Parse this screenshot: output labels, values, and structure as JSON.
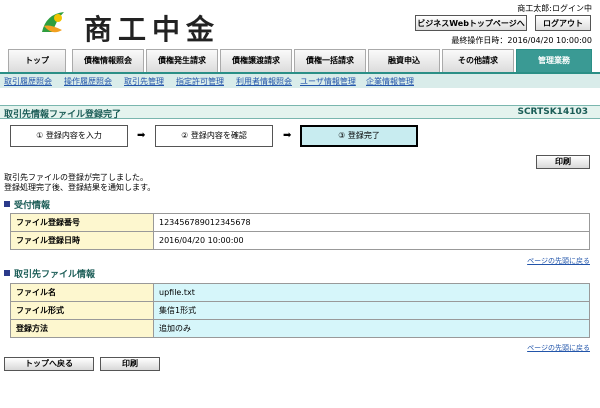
{
  "header": {
    "bank_name": "商工中金",
    "user": "商工太郎:ログイン中",
    "web_top_button": "ビジネスWebトップページへ",
    "logout_button": "ログアウト",
    "last_operation": "最終操作日時：2016/04/20 10:00:00"
  },
  "tabs": [
    {
      "label": "トップ"
    },
    {
      "label": "債権情報照会"
    },
    {
      "label": "債権発生請求"
    },
    {
      "label": "債権譲渡請求"
    },
    {
      "label": "債権一括請求"
    },
    {
      "label": "融資申込"
    },
    {
      "label": "その他請求"
    },
    {
      "label": "管理業務"
    }
  ],
  "subnav": [
    "取引履歴照会",
    "操作履歴照会",
    "取引先管理",
    "指定許可管理",
    "利用者情報照会",
    "ユーザ情報管理",
    "企業情報管理"
  ],
  "page": {
    "title": "取引先情報ファイル登録完了",
    "screen_id": "SCRTSK14103"
  },
  "steps": [
    {
      "label": "① 登録内容を入力"
    },
    {
      "label": "② 登録内容を確認"
    },
    {
      "label": "③ 登録完了"
    }
  ],
  "arrow": "➡",
  "print_label": "印刷",
  "messages": [
    "取引先ファイルの登録が完了しました。",
    "登録処理完了後、登録結果を通知します。"
  ],
  "receipt_section": {
    "title": "受付情報",
    "rows": [
      {
        "label": "ファイル登録番号",
        "value": "123456789012345678"
      },
      {
        "label": "ファイル登録日時",
        "value": "2016/04/20 10:00:00"
      }
    ]
  },
  "file_section": {
    "title": "取引先ファイル情報",
    "rows": [
      {
        "label": "ファイル名",
        "value": "upfile.txt"
      },
      {
        "label": "ファイル形式",
        "value": "集信1形式"
      },
      {
        "label": "登録方法",
        "value": "追加のみ"
      }
    ]
  },
  "page_top_link": "ページの先頭に戻る",
  "back_to_top_button": "トップへ戻る"
}
